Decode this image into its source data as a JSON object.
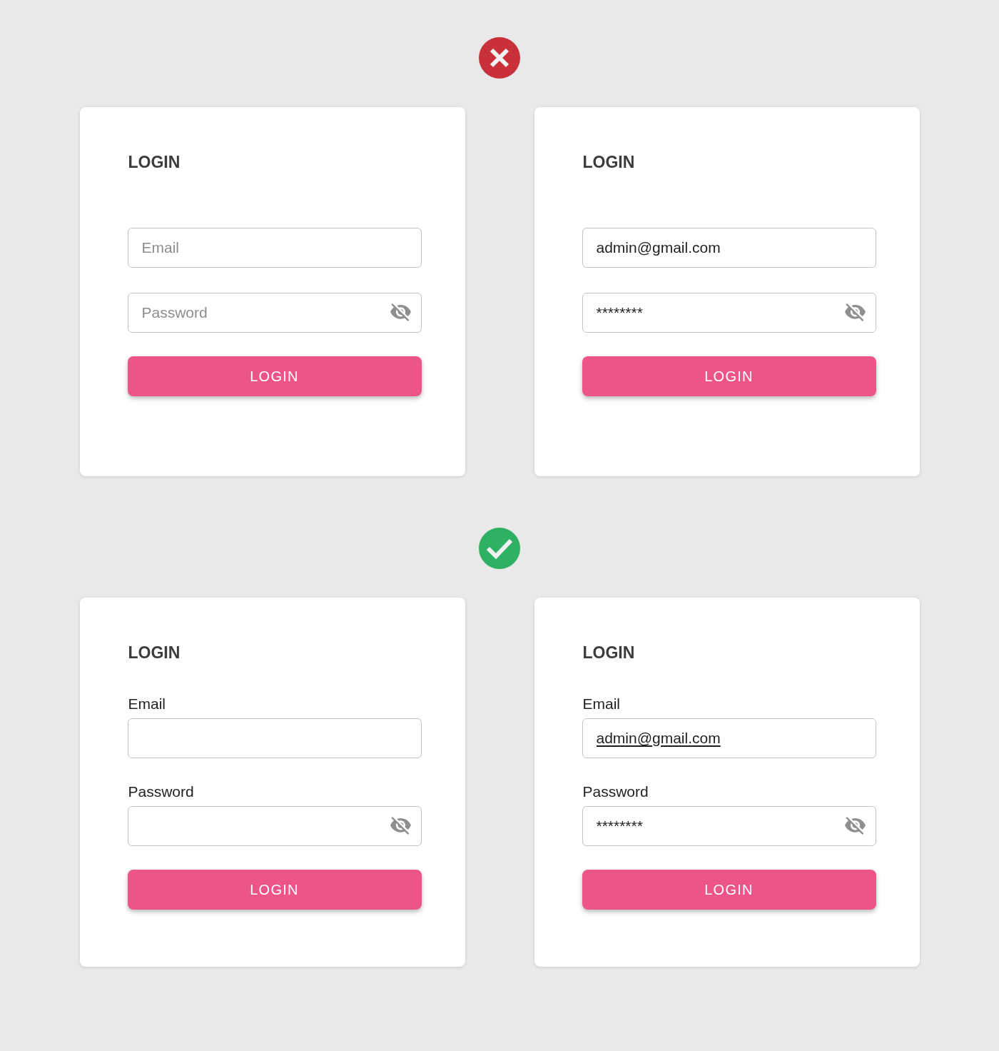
{
  "sections": [
    {
      "verdict": {
        "kind": "wrong"
      },
      "cards": [
        {
          "title": "LOGIN",
          "fields": [
            {
              "kind": "email",
              "placeholder": "Email",
              "underlined": false
            },
            {
              "kind": "password",
              "placeholder": "Password",
              "underlined": false
            }
          ],
          "button": "LOGIN"
        },
        {
          "title": "LOGIN",
          "fields": [
            {
              "kind": "email",
              "value": "admin@gmail.com",
              "underlined": false
            },
            {
              "kind": "password",
              "value": "********",
              "underlined": false
            }
          ],
          "button": "LOGIN"
        }
      ]
    },
    {
      "verdict": {
        "kind": "right"
      },
      "cards": [
        {
          "title": "LOGIN",
          "fields": [
            {
              "kind": "email",
              "label": "Email"
            },
            {
              "kind": "password",
              "label": "Password"
            }
          ],
          "button": "LOGIN"
        },
        {
          "title": "LOGIN",
          "fields": [
            {
              "kind": "email",
              "label": "Email",
              "value": "admin@gmail.com",
              "underlined": true
            },
            {
              "kind": "password",
              "label": "Password",
              "value": "********",
              "underlined": false
            }
          ],
          "button": "LOGIN"
        }
      ]
    }
  ]
}
